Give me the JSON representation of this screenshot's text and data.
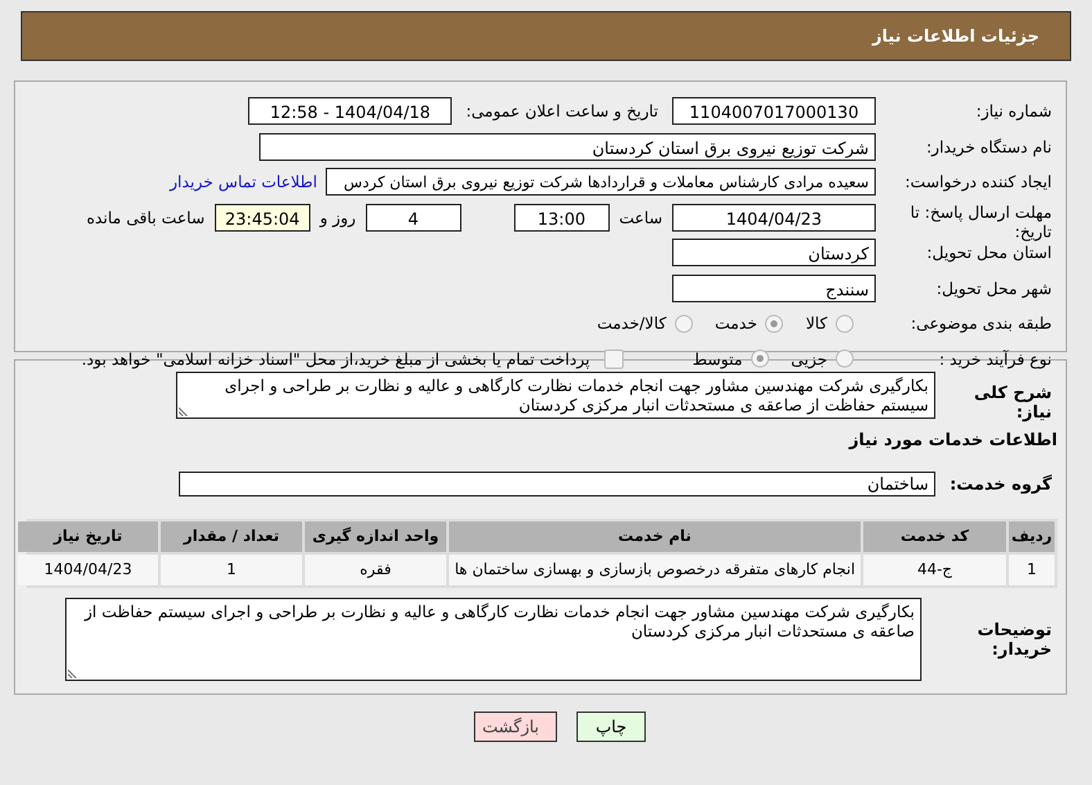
{
  "header": {
    "title": "جزئیات اطلاعات نیاز"
  },
  "need_number": {
    "label": "شماره نیاز:",
    "value": "1104007017000130"
  },
  "announce_date": {
    "label": "تاریخ و ساعت اعلان عمومی:",
    "value": "1404/04/18 - 12:58"
  },
  "buyer_org": {
    "label": "نام دستگاه خریدار:",
    "value": "شرکت توزیع نیروی برق استان کردستان"
  },
  "requester": {
    "label": "ایجاد کننده درخواست:",
    "value": "سعیده مرادی کارشناس معاملات و قراردادها شرکت توزیع نیروی برق استان کردس",
    "link": "اطلاعات تماس خریدار"
  },
  "deadline": {
    "label": "مهلت ارسال پاسخ: تا تاریخ:",
    "date": "1404/04/23",
    "time_label": "ساعت",
    "time": "13:00",
    "days": "4",
    "days_label": "روز و",
    "remaining": "23:45:04",
    "remaining_label": "ساعت باقی مانده"
  },
  "province": {
    "label": "استان محل تحویل:",
    "value": "کردستان"
  },
  "city": {
    "label": "شهر محل تحویل:",
    "value": "سنندج"
  },
  "category": {
    "label": "طبقه بندی موضوعی:",
    "options": [
      {
        "label": "کالا",
        "selected": false
      },
      {
        "label": "خدمت",
        "selected": true
      },
      {
        "label": "کالا/خدمت",
        "selected": false
      }
    ]
  },
  "purchase_type": {
    "label": "نوع فرآیند خرید :",
    "options": [
      {
        "label": "جزیی",
        "selected": false
      },
      {
        "label": "متوسط",
        "selected": true
      }
    ],
    "payment": {
      "checked": false,
      "text": "پرداخت تمام یا بخشی از مبلغ خرید،از محل \"اسناد خزانه اسلامی\" خواهد بود."
    }
  },
  "description": {
    "label": "شرح کلی نیاز:",
    "value": "بکارگیری شرکت مهندسین مشاور جهت انجام خدمات نظارت کارگاهی و عالیه و نظارت بر طراحی و اجرای سیستم حفاظت از صاعقه ی مستحدثات انبار مرکزی کردستان"
  },
  "services_title": "اطلاعات خدمات مورد نیاز",
  "service_group": {
    "label": "گروه خدمت:",
    "value": "ساختمان"
  },
  "table": {
    "columns": [
      "ردیف",
      "کد خدمت",
      "نام خدمت",
      "واحد اندازه گیری",
      "تعداد / مقدار",
      "تاریخ نیاز"
    ],
    "rows": [
      [
        "1",
        "ج-44",
        "انجام کارهای متفرقه درخصوص بازسازی و بهسازی ساختمان ها",
        "فقره",
        "1",
        "1404/04/23"
      ]
    ]
  },
  "buyer_notes": {
    "label": "توضیحات خریدار:",
    "value": "بکارگیری شرکت مهندسین مشاور جهت انجام خدمات نظارت کارگاهی و عالیه و نظارت بر طراحی و اجرای سیستم حفاظت از صاعقه ی مستحدثات انبار مرکزی کردستان"
  },
  "buttons": [
    {
      "label": "چاپ",
      "kind": "print"
    },
    {
      "label": "بازگشت",
      "kind": "back"
    }
  ]
}
